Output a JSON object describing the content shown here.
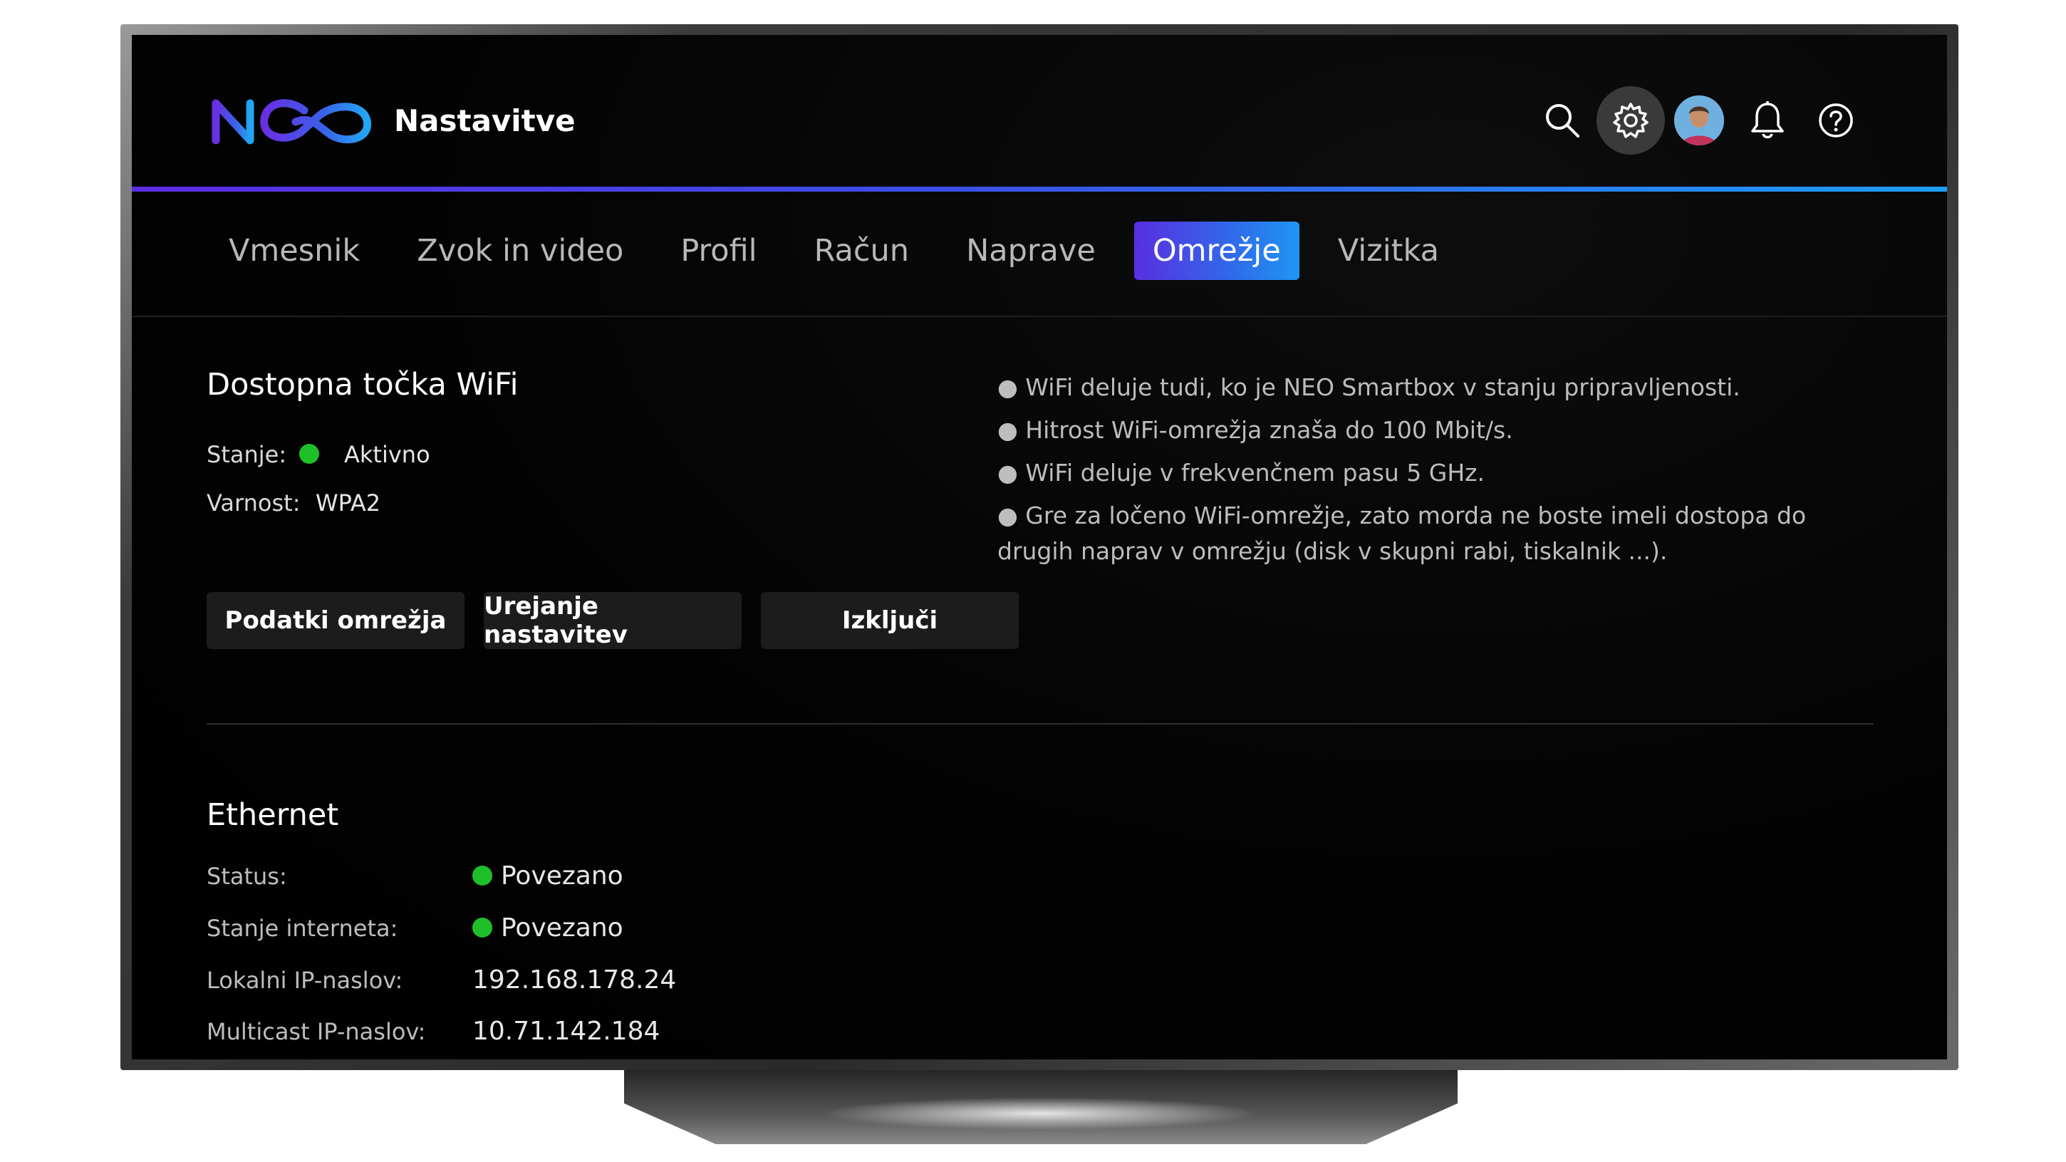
{
  "header": {
    "title": "Nastavitve",
    "icons": [
      "search-icon",
      "gear-icon",
      "avatar",
      "bell-icon",
      "help-icon"
    ]
  },
  "tabs": [
    {
      "label": "Vmesnik",
      "active": false
    },
    {
      "label": "Zvok in video",
      "active": false
    },
    {
      "label": "Profil",
      "active": false
    },
    {
      "label": "Račun",
      "active": false
    },
    {
      "label": "Naprave",
      "active": false
    },
    {
      "label": "Omrežje",
      "active": true
    },
    {
      "label": "Vizitka",
      "active": false
    }
  ],
  "wifi": {
    "title": "Dostopna točka WiFi",
    "state_label": "Stanje:",
    "state_value": "Aktivno",
    "security_label": "Varnost:",
    "security_value": "WPA2",
    "notes": [
      "WiFi deluje tudi, ko je NEO Smartbox v stanju pripravljenosti.",
      "Hitrost WiFi-omrežja znaša do 100 Mbit/s.",
      "WiFi deluje v frekvenčnem pasu 5 GHz.",
      "Gre za ločeno WiFi-omrežje, zato morda ne boste imeli dostopa do drugih naprav v omrežju (disk v skupni rabi, tiskalnik ...)."
    ],
    "buttons": {
      "details": "Podatki omrežja",
      "edit": "Urejanje nastavitev",
      "disable": "Izključi"
    }
  },
  "ethernet": {
    "title": "Ethernet",
    "rows": [
      {
        "label": "Status:",
        "value": "Povezano",
        "status_dot": true
      },
      {
        "label": "Stanje interneta:",
        "value": "Povezano",
        "status_dot": true
      },
      {
        "label": "Lokalni IP-naslov:",
        "value": "192.168.178.24",
        "status_dot": false
      },
      {
        "label": "Multicast IP-naslov:",
        "value": "10.71.142.184",
        "status_dot": false
      }
    ]
  },
  "colors": {
    "accent_start": "#5a2ee0",
    "accent_end": "#1f96f3",
    "status_ok": "#1fbf2a"
  }
}
